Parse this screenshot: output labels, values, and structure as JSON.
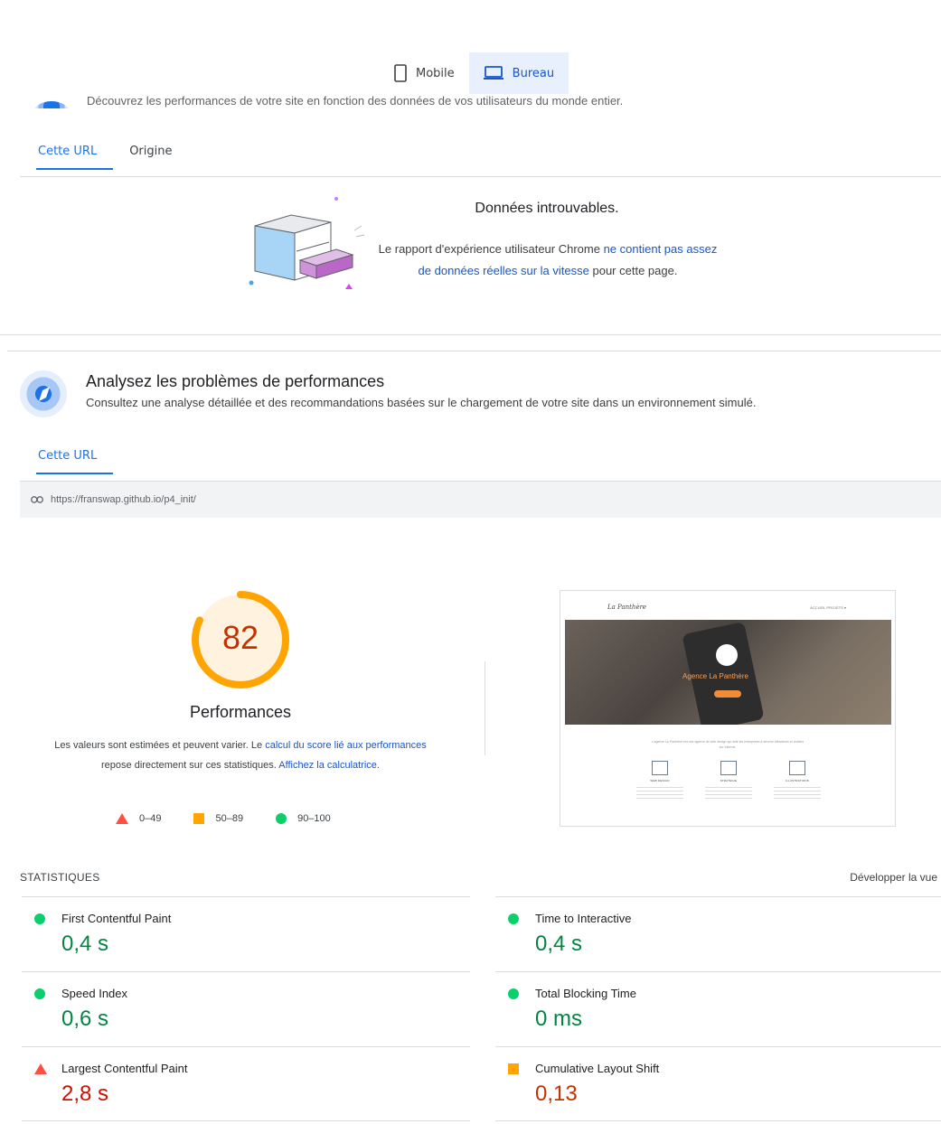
{
  "device_toggle": {
    "mobile_label": "Mobile",
    "desktop_label": "Bureau",
    "active": "Bureau"
  },
  "field_section": {
    "clipped_subtitle": "Découvrez les performances de votre site en fonction des données de vos utilisateurs du monde entier.",
    "tabs": [
      {
        "label": "Cette URL",
        "active": true
      },
      {
        "label": "Origine",
        "active": false
      }
    ],
    "empty_title": "Données introuvables.",
    "empty_text_before": "Le rapport d'expérience utilisateur Chrome ",
    "empty_link": "ne contient pas assez de données réelles sur la vitesse",
    "empty_text_after": " pour cette page."
  },
  "lab_section": {
    "title": "Analysez les problèmes de performances",
    "subtitle": "Consultez une analyse détaillée et des recommandations basées sur le chargement de votre site dans un environnement simulé.",
    "tabs": [
      {
        "label": "Cette URL",
        "active": true
      }
    ],
    "url": "https://franswap.github.io/p4_init/"
  },
  "score": {
    "value": "82",
    "fraction": 0.82,
    "label": "Performances",
    "desc_before": "Les valeurs sont estimées et peuvent varier. Le ",
    "desc_link1": "calcul du score lié aux performances",
    "desc_middle": " repose directement sur ces statistiques. ",
    "desc_link2": "Affichez la calculatrice.",
    "legend": [
      {
        "shape": "triangle",
        "range": "0–49",
        "color": "#ff4e42"
      },
      {
        "shape": "square",
        "range": "50–89",
        "color": "#ffa400"
      },
      {
        "shape": "circle",
        "range": "90–100",
        "color": "#0cce6b"
      }
    ],
    "ring_color": "#ffa400",
    "score_color": "#c33300"
  },
  "preview": {
    "logo": "La Panthère",
    "menu": "ACCUEIL   PROJETS ▾",
    "hero_title": "Agence La Panthère",
    "body_text": "L'agence La Panthère est une agence de web design qui aide les entreprises à devenir attractives et visibles sur Internet.",
    "columns": [
      "WEB DESIGN",
      "STRATEGIE",
      "ILLUSTRATIONS"
    ]
  },
  "statistics": {
    "heading": "STATISTIQUES",
    "expand_label": "Développer la vue",
    "metrics": [
      {
        "name": "First Contentful Paint",
        "value": "0,4 s",
        "status": "pass"
      },
      {
        "name": "Time to Interactive",
        "value": "0,4 s",
        "status": "pass"
      },
      {
        "name": "Speed Index",
        "value": "0,6 s",
        "status": "pass"
      },
      {
        "name": "Total Blocking Time",
        "value": "0 ms",
        "status": "pass"
      },
      {
        "name": "Largest Contentful Paint",
        "value": "2,8 s",
        "status": "fail"
      },
      {
        "name": "Cumulative Layout Shift",
        "value": "0,13",
        "status": "average"
      }
    ]
  }
}
